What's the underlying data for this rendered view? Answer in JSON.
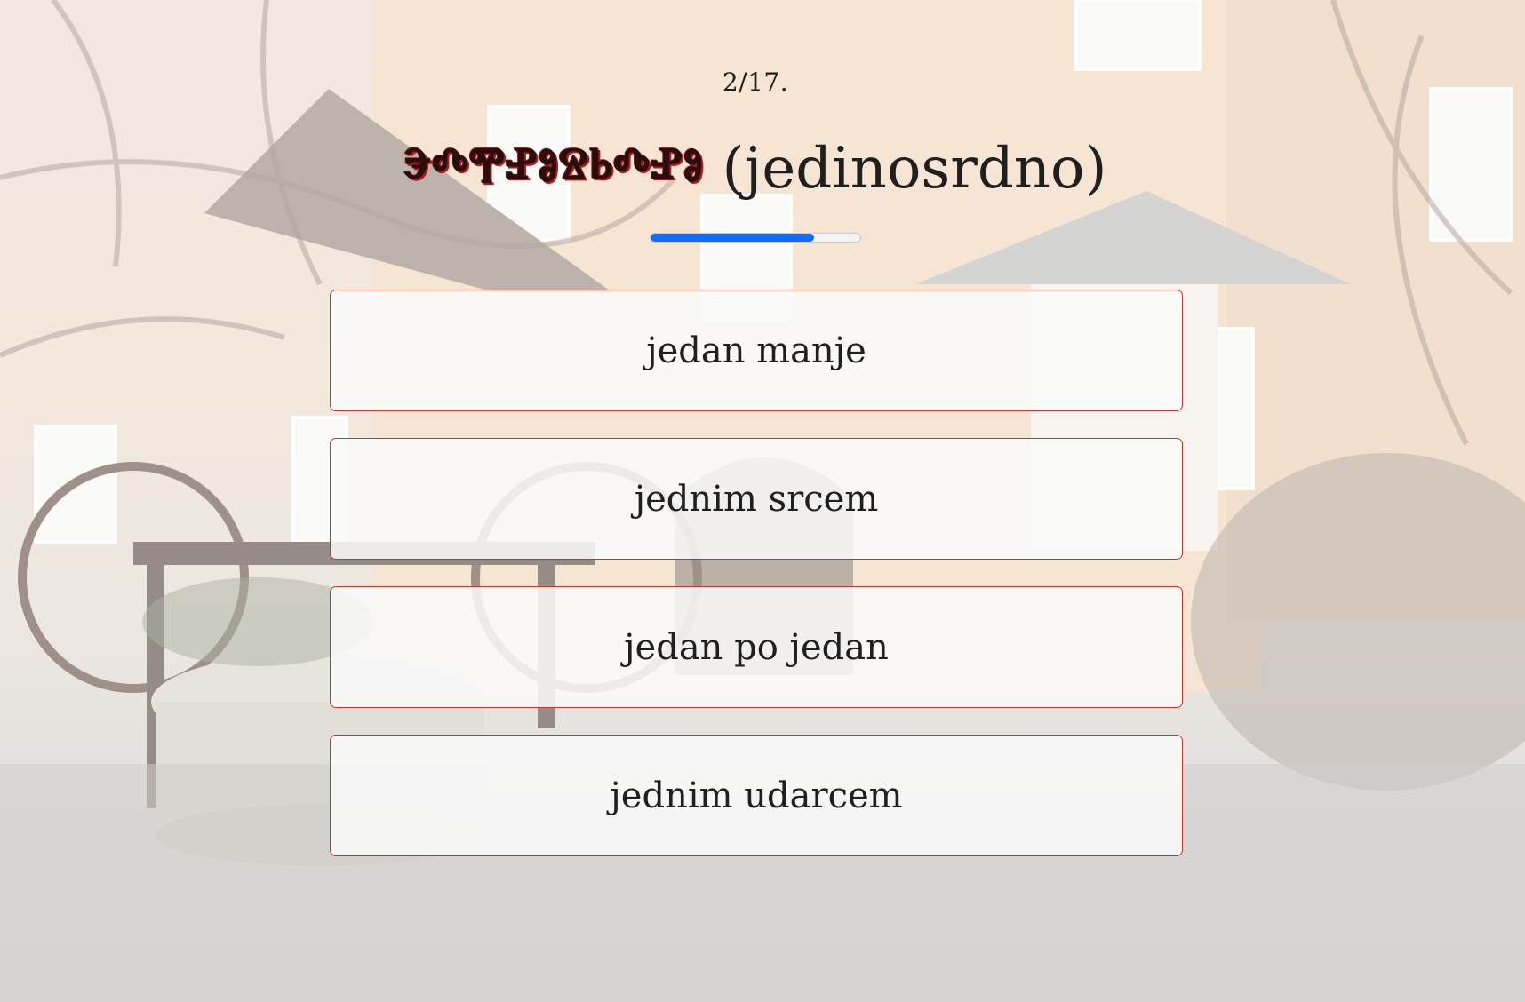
{
  "quiz": {
    "counter": "2/17.",
    "question": {
      "glagolitic_word": "ⰵⰴⰹⱀⱁⱄⱃⰴⱀⱁ",
      "latin_word": "(jedinosrdno)"
    },
    "progress": {
      "value": 0.78,
      "color": "#0d6efd"
    },
    "answers": [
      {
        "label": "jedan manje"
      },
      {
        "label": "jednim srcem"
      },
      {
        "label": "jedan po jedan"
      },
      {
        "label": "jednim udarcem"
      }
    ],
    "answer_border_color": "#c0392b"
  },
  "background": {
    "description_icon": "courtyard-photo"
  }
}
